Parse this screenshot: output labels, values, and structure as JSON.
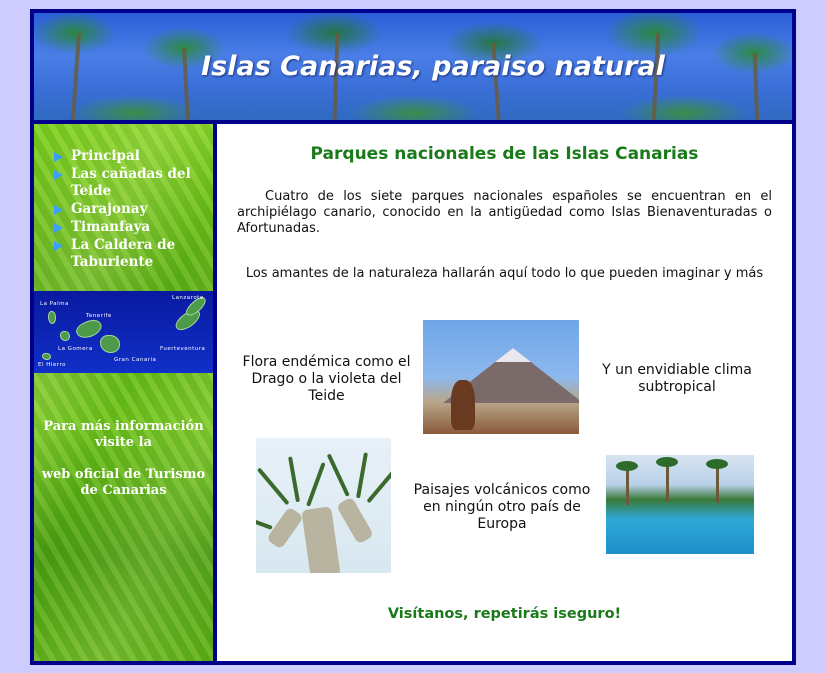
{
  "header": {
    "title": "Islas Canarias, paraiso natural"
  },
  "sidebar": {
    "nav": [
      {
        "label": "Principal"
      },
      {
        "label": "Las cañadas del Teide"
      },
      {
        "label": "Garajonay"
      },
      {
        "label": "Timanfaya"
      },
      {
        "label": "La Caldera de Taburiente"
      }
    ],
    "map_labels": [
      "La Palma",
      "Tenerife",
      "Lanzarote",
      "La Gomera",
      "El Hierro",
      "Gran Canaria",
      "Fuerteventura"
    ],
    "info_line1": "Para más información visite la",
    "info_link": "web oficial de Turismo de Canarias"
  },
  "main": {
    "heading": "Parques nacionales de las Islas Canarias",
    "paragraph1": "Cuatro de los siete parques nacionales españoles se encuentran en el archipiélago canario, conocido en la antigüedad como Islas Bienaventuradas o Afortunadas.",
    "paragraph2": "Los amantes de la naturaleza hallarán aquí todo lo que pueden imaginar y más",
    "caption_flora": "Flora endémica como el Drago o la violeta del Teide",
    "caption_clima": "Y un envidiable clima subtropical",
    "caption_paisajes": "Paisajes volcánicos como en ningún otro país de Europa",
    "closing": "Visítanos, repetirás iseguro!"
  },
  "colors": {
    "page_bg": "#ccccff",
    "frame": "#00008b",
    "heading_green": "#1a7a1a"
  }
}
